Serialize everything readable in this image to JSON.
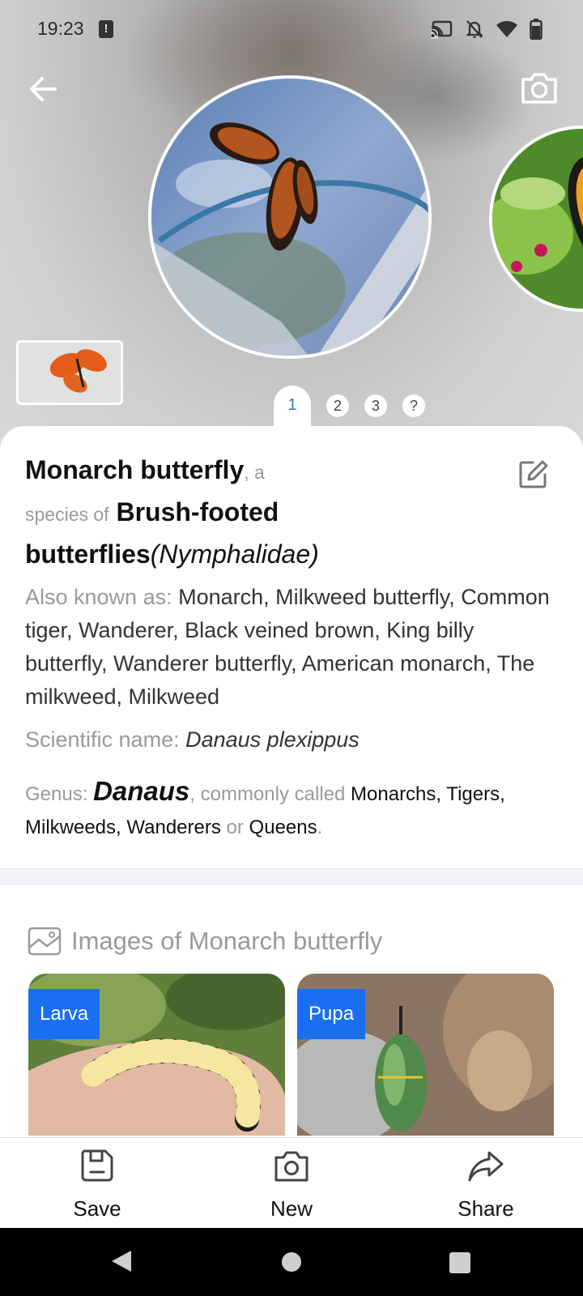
{
  "status_bar": {
    "time": "19:23",
    "alert": "!"
  },
  "pager": {
    "active": "1",
    "pages": [
      "2",
      "3",
      "?"
    ]
  },
  "species": {
    "common_name": "Monarch butterfly",
    "connector_a": ", a",
    "connector_species_of": "species of",
    "family_common": "Brush-footed butterflies",
    "family_scientific": "(Nymphalidae)",
    "aka_label": "Also known as:",
    "aka_value": "Monarch, Milkweed butterfly, Common tiger, Wanderer, Black veined brown, King billy butterfly, Wanderer butterfly, American monarch, The milkweed, Milkweed",
    "sci_label": "Scientific name:",
    "sci_value": "Danaus plexippus",
    "genus_label": "Genus:",
    "genus_name": "Danaus",
    "genus_commonly": ", commonly called",
    "genus_common_names": "Monarchs, Tigers, Milkweeds, Wanderers",
    "genus_or": "or",
    "genus_last": "Queens",
    "genus_period": "."
  },
  "images_section": {
    "title": "Images of Monarch butterfly",
    "items": [
      {
        "tag": "Larva"
      },
      {
        "tag": "Pupa"
      }
    ]
  },
  "bottom_bar": {
    "save": "Save",
    "new": "New",
    "share": "Share"
  },
  "colors": {
    "accent": "#1a6ff0",
    "pager_active": "#2b72c8",
    "muted_text": "#9a9a9a"
  }
}
